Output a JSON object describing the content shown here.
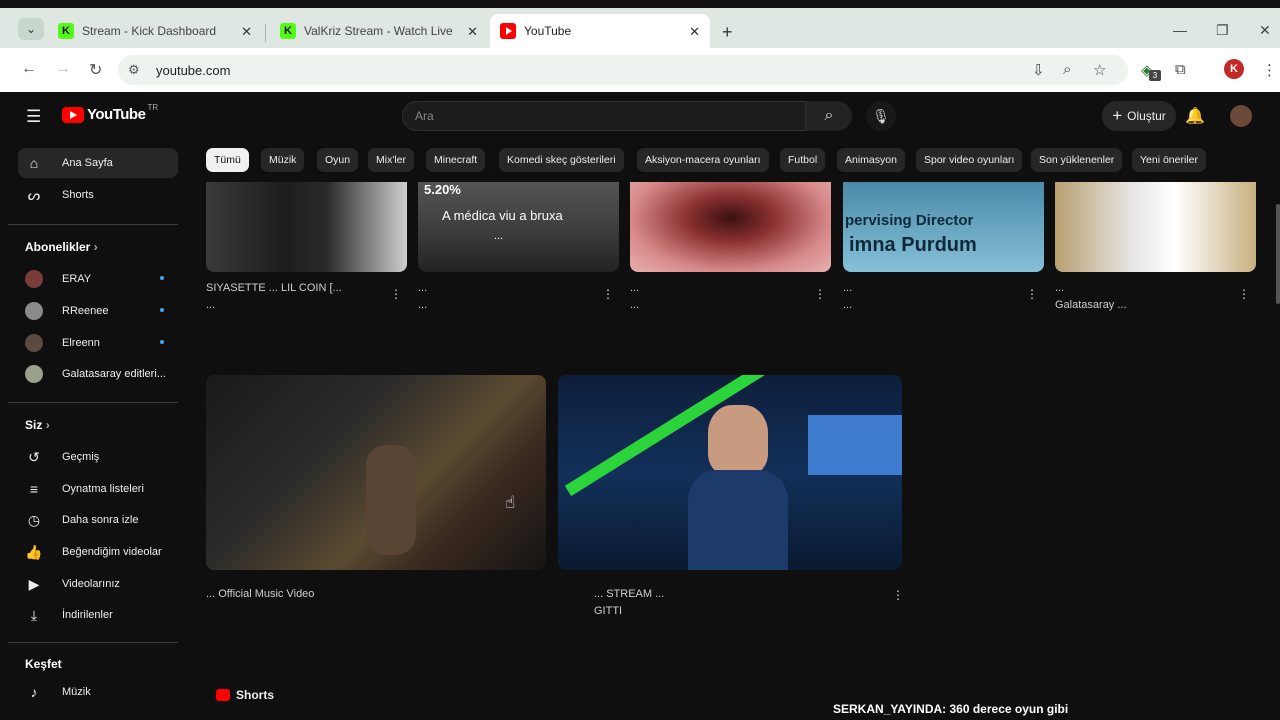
{
  "browser": {
    "tabs": [
      {
        "title": "Stream - Kick Dashboard",
        "favicon": "K"
      },
      {
        "title": "ValKriz Stream - Watch Live on Kick",
        "favicon": "K"
      },
      {
        "title": "YouTube",
        "favicon": "youtube-icon"
      }
    ],
    "url": "youtube.com",
    "profile_initial": "K",
    "extension_badge": "3"
  },
  "youtube": {
    "logo_text": "YouTube",
    "country_code": "TR",
    "search_placeholder": "Ara",
    "create_label": "Oluştur",
    "sidebar": {
      "main": [
        {
          "label": "Ana Sayfa",
          "icon": "home-icon"
        },
        {
          "label": "Shorts",
          "icon": "shorts-icon"
        }
      ],
      "subscriptions_heading": "Abonelikler",
      "subscriptions": [
        {
          "label": "ERAY",
          "color": "#7a3b3b"
        },
        {
          "label": "RReenee",
          "color": "#8a8a8a"
        },
        {
          "label": "Elreenn",
          "color": "#5b4a40"
        },
        {
          "label": "Galatasaray editleri...",
          "color": "#9aa08a"
        }
      ],
      "you_heading": "Siz",
      "you_items": [
        {
          "label": "Geçmiş",
          "icon": "history-icon"
        },
        {
          "label": "Oynatma listeleri",
          "icon": "playlist-icon"
        },
        {
          "label": "Daha sonra izle",
          "icon": "clock-icon"
        },
        {
          "label": "Beğendiğim videolar",
          "icon": "like-icon"
        },
        {
          "label": "Videolarınız",
          "icon": "video-icon"
        },
        {
          "label": "İndirilenler",
          "icon": "download-icon"
        }
      ],
      "explore_heading": "Keşfet",
      "explore_items": [
        {
          "label": "Müzik",
          "icon": "music-icon"
        }
      ]
    },
    "chips": [
      "Tümü",
      "Müzik",
      "Oyun",
      "Mix'ler",
      "Minecraft",
      "Komedi skeç gösterileri",
      "Aksiyon-macera oyunları",
      "Futbol",
      "Animasyon",
      "Spor video oyunları",
      "Son yüklenenler",
      "Yeni öneriler"
    ],
    "row1_videos": [
      {
        "overlay": "",
        "title": "SIYASETTE ... LIL COIN [...",
        "title2": "...",
        "meta": ""
      },
      {
        "overlay": "5.20%",
        "overlay2": "A médica viu a bruxa",
        "overlay3": "...",
        "title": "...",
        "title2": "...",
        "meta": ""
      },
      {
        "overlay": "",
        "title": "...",
        "title2": "...",
        "meta": ""
      },
      {
        "overlay": "pervising Director",
        "overlay2": "imna Purdum",
        "title": "...",
        "title2": "...",
        "meta": ""
      },
      {
        "overlay": "",
        "title": "...",
        "title2": "Galatasaray ...",
        "meta": ""
      }
    ],
    "row2_videos": [
      {
        "title": "... Official Music Video",
        "meta": ""
      },
      {
        "title": "... STREAM ... ",
        "title2": "GITTI",
        "meta": ""
      }
    ],
    "shorts_label": "Shorts"
  },
  "stream_chat": {
    "user": "SERKAN_YAYINDA",
    "message": ": 360 derece oyun gibi"
  }
}
